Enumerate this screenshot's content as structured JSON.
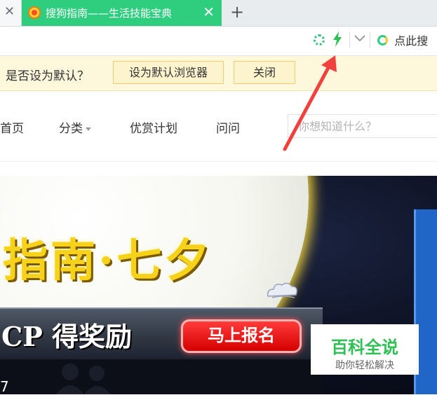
{
  "browser": {
    "tab": {
      "title": "搜狗指南——生活技能宝典",
      "close": "✕"
    },
    "previous_tab_close": "✕",
    "new_tab": "+",
    "search_placeholder": "点此搜"
  },
  "notification": {
    "question": "是否设为默认？",
    "set_default_button": "设为默认浏览器",
    "close_button": "关闭"
  },
  "site_nav": {
    "items": [
      "首页",
      "分类",
      "优赏计划",
      "问问"
    ],
    "search_placeholder": "你想知道什么？"
  },
  "banner": {
    "headline": "指南·七夕",
    "subline": "CP 得奖励",
    "cta": "马上报名",
    "corner": "7"
  },
  "baike": {
    "title": "百科全说",
    "subtitle": "助你轻松解决"
  },
  "colors": {
    "tab_active": "#2fce7f",
    "notice_bg": "#fdf7dc",
    "annotation_arrow": "#f0413c",
    "baike_green": "#2fbf55"
  }
}
